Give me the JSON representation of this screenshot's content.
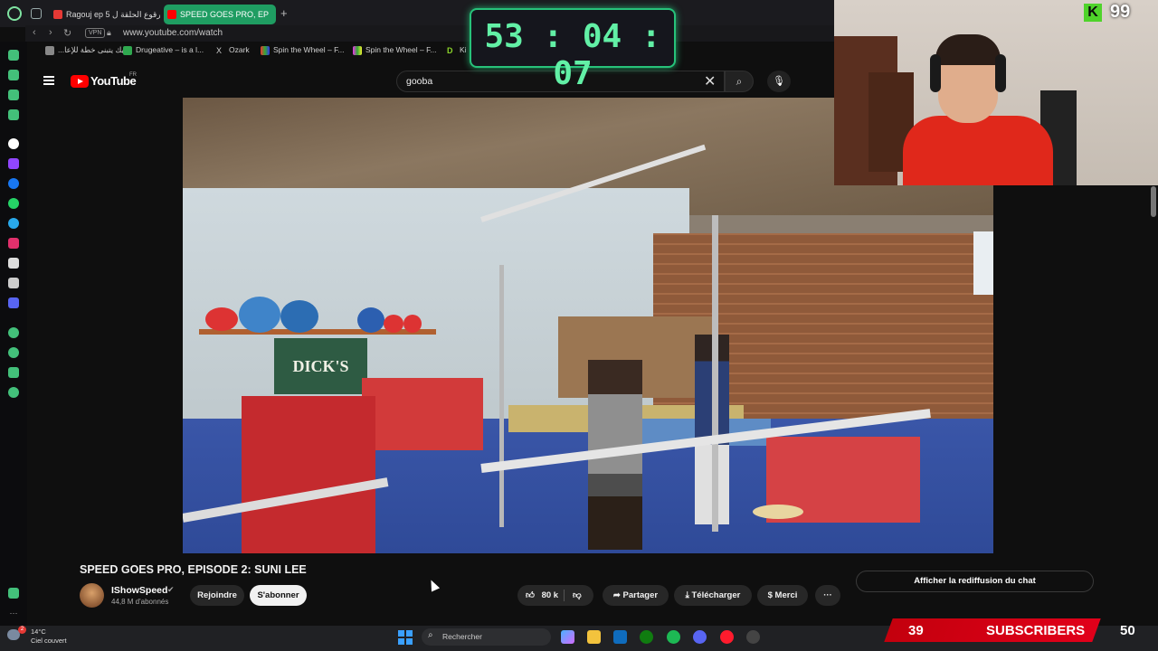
{
  "browser": {
    "tabs": [
      {
        "label": "Ragouj ep 5 الحلقة 5 رقوع الحلقة ل..."
      },
      {
        "label": "SPEED GOES PRO, EP"
      }
    ],
    "new_tab": "+",
    "vpn": "VPN",
    "url": "www.youtube.com/watch",
    "bookmarks": [
      {
        "label": "...فليك يتبنى خطة للإعا"
      },
      {
        "label": "Drugeative – is a l..."
      },
      {
        "label": "Ozark"
      },
      {
        "label": "Spin the Wheel – F..."
      },
      {
        "label": "Spin the Wheel – F..."
      },
      {
        "label": "Ki"
      }
    ]
  },
  "youtube": {
    "logo": "YouTube",
    "region": "FR",
    "search_value": "gooba",
    "video_sign": "DICK'S",
    "title": "SPEED GOES PRO, EPISODE 2: SUNI LEE",
    "channel": {
      "name": "IShowSpeed",
      "verified": "✔",
      "subscribers": "44,8 M d'abonnés"
    },
    "buttons": {
      "join": "Rejoindre",
      "subscribe": "S'abonner",
      "likes": "80 k",
      "share": "Partager",
      "download": "Télécharger",
      "thanks": "Merci",
      "more": "···"
    },
    "chat_replay": "Afficher la rediffusion du chat"
  },
  "overlay": {
    "timer": "53 : 04 : 07",
    "kick_badge": "K",
    "kick_count": "99",
    "sub_count": "39",
    "sub_label": "SUBSCRIBERS",
    "sub_goal": "50"
  },
  "taskbar": {
    "temperature": "14°C",
    "weather": "Ciel couvert",
    "notifications": "2",
    "search_placeholder": "Rechercher"
  },
  "icons": {
    "accent": "#27c27a",
    "youtube_red": "#ff0000",
    "subscribe_bg": "#f1f1f1",
    "banner_red": "#e1001a"
  }
}
